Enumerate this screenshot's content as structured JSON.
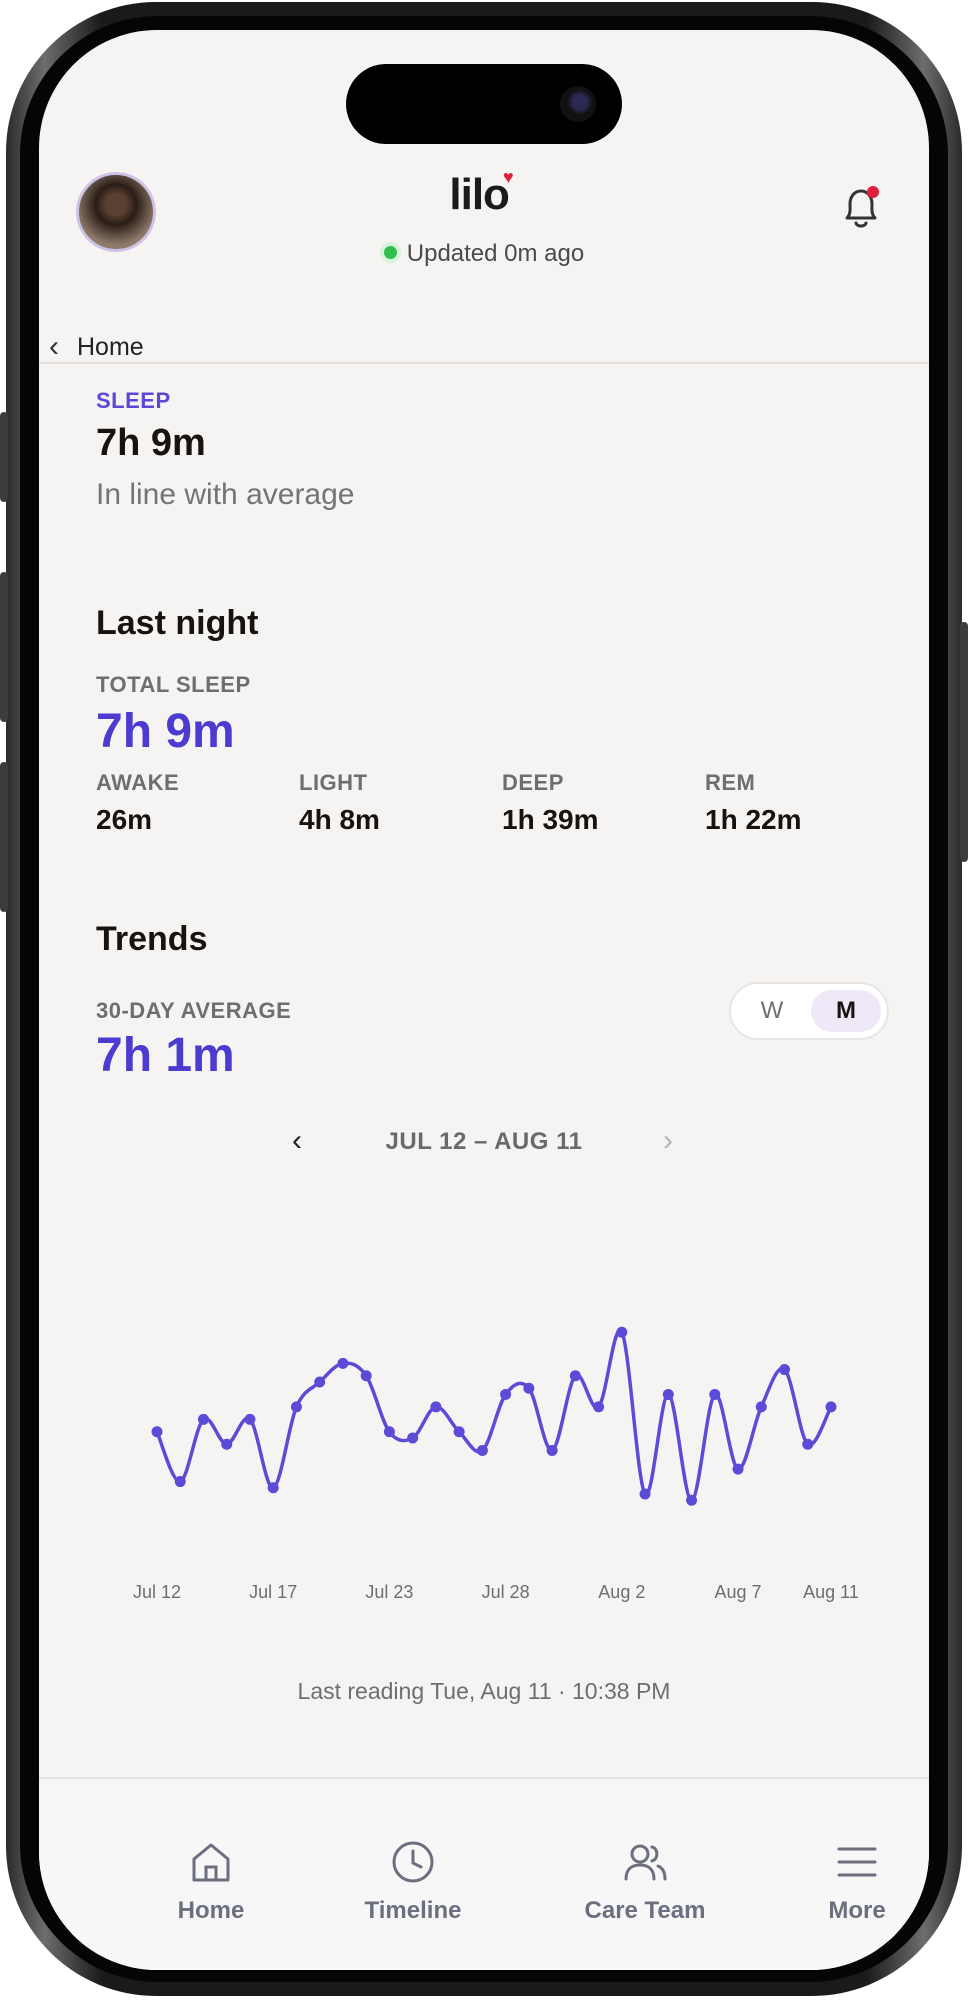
{
  "header": {
    "logo_text": "lilo",
    "updated_text": "Updated 0m ago",
    "back_label": "Home"
  },
  "summary": {
    "section_label": "SLEEP",
    "duration": "7h 9m",
    "comparison": "In line with average"
  },
  "last_night": {
    "title": "Last night",
    "total_label": "TOTAL SLEEP",
    "total_value": "7h 9m",
    "stages": [
      {
        "label": "AWAKE",
        "value": "26m"
      },
      {
        "label": "LIGHT",
        "value": "4h 8m"
      },
      {
        "label": "DEEP",
        "value": "1h 39m"
      },
      {
        "label": "REM",
        "value": "1h 22m"
      }
    ]
  },
  "trends": {
    "title": "Trends",
    "avg_label": "30-DAY AVERAGE",
    "avg_value": "7h 1m",
    "toggle": {
      "week": "W",
      "month": "M",
      "selected": "M"
    },
    "range_label": "JUL 12 – AUG 11"
  },
  "chart_data": {
    "type": "line",
    "title": "",
    "xlabel": "",
    "ylabel": "",
    "x_tick_labels": [
      "Jul 12",
      "Jul 17",
      "Jul 23",
      "Jul 28",
      "Aug 2",
      "Aug 7",
      "Aug 11"
    ],
    "x_tick_index": [
      0,
      5,
      10,
      15,
      20,
      25,
      29
    ],
    "values": [
      6.9,
      6.1,
      7.1,
      6.7,
      7.1,
      6.0,
      7.3,
      7.7,
      8.0,
      7.8,
      6.9,
      6.8,
      7.3,
      6.9,
      6.6,
      7.5,
      7.6,
      6.6,
      7.8,
      7.3,
      8.5,
      5.9,
      7.5,
      5.8,
      7.5,
      6.3,
      7.3,
      7.9,
      6.7,
      7.3
    ],
    "ylim": [
      5.0,
      9.5
    ],
    "color": "#5b4bd6",
    "grid": false,
    "legend": "none"
  },
  "footer_note": "Last reading Tue, Aug 11 · 10:38 PM",
  "tabbar": [
    {
      "label": "Home",
      "icon": "home-icon"
    },
    {
      "label": "Timeline",
      "icon": "clock-icon"
    },
    {
      "label": "Care Team",
      "icon": "people-icon"
    },
    {
      "label": "More",
      "icon": "menu-icon"
    }
  ],
  "colors": {
    "accent": "#4b3bd0",
    "status_online": "#2fbf4a",
    "notification": "#e0203a"
  }
}
